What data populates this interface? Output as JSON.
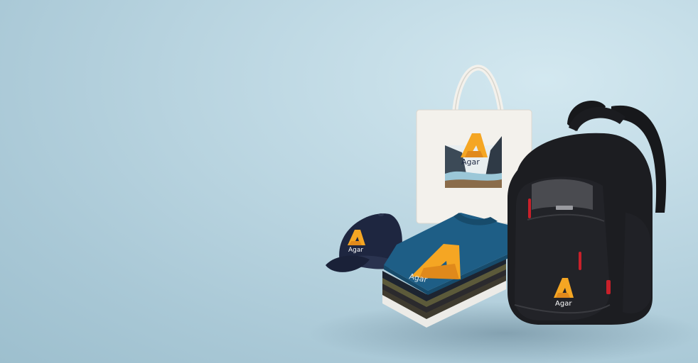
{
  "brand": {
    "logo_text": "Agar",
    "accent_color": "#f5a623",
    "navy_color": "#1f2a44"
  },
  "products": [
    {
      "name": "Tote bag"
    },
    {
      "name": "Baseball cap"
    },
    {
      "name": "Folded T-shirts"
    },
    {
      "name": "Backpack"
    }
  ]
}
